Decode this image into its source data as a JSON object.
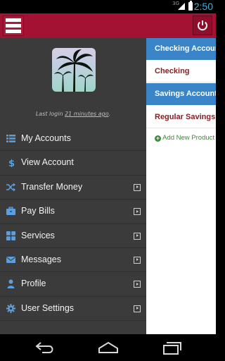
{
  "status_bar": {
    "network": "3G",
    "time": "2:50"
  },
  "header": {
    "menu_icon": "hamburger-icon",
    "power_icon": "power-icon"
  },
  "drawer": {
    "last_login_prefix": "Last login ",
    "last_login_time": "21 minutes ago",
    "last_login_suffix": ".",
    "items": [
      {
        "label": "My Accounts",
        "icon": "list-icon",
        "has_arrow": false
      },
      {
        "label": "View Account",
        "icon": "dollar-icon",
        "has_arrow": false
      },
      {
        "label": "Transfer Money",
        "icon": "shuffle-icon",
        "has_arrow": true
      },
      {
        "label": "Pay Bills",
        "icon": "briefcase-icon",
        "has_arrow": true
      },
      {
        "label": "Services",
        "icon": "grid-icon",
        "has_arrow": true
      },
      {
        "label": "Messages",
        "icon": "envelope-icon",
        "has_arrow": true
      },
      {
        "label": "Profile",
        "icon": "user-icon",
        "has_arrow": true
      },
      {
        "label": "User Settings",
        "icon": "gear-icon",
        "has_arrow": true
      }
    ]
  },
  "content": {
    "checking_header": "Checking Account",
    "checking_item": "Checking",
    "savings_header": "Savings Account",
    "savings_item": "Regular Savings",
    "add_new_product": "Add New Product"
  },
  "colors": {
    "header": "#a31232",
    "drawer": "#3b3b3b",
    "section_header": "#3a85c8",
    "account_text": "#8a1f24",
    "add_product": "#3c8b3c"
  }
}
